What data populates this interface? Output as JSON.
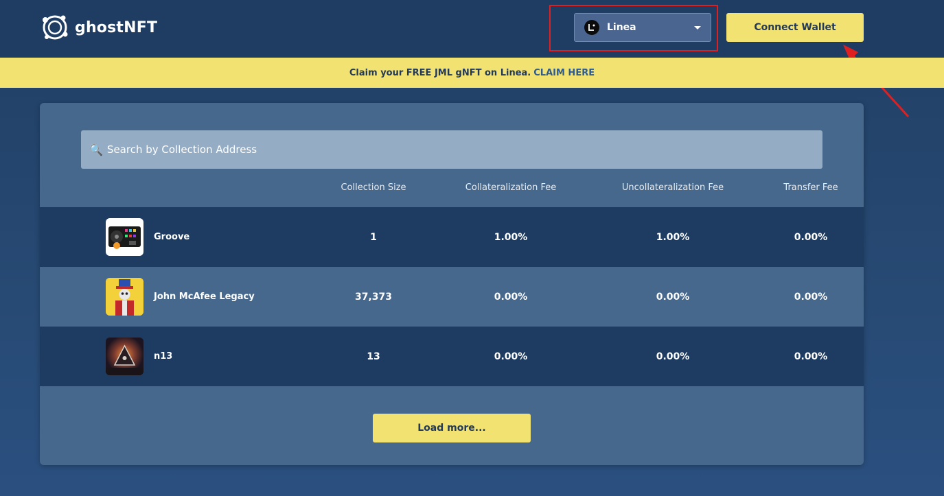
{
  "header": {
    "logo_text": "ghostNFT",
    "network": {
      "label": "Linea",
      "icon": "linea-logo-icon"
    },
    "connect_wallet_label": "Connect Wallet"
  },
  "banner": {
    "text": "Claim your FREE JML gNFT on Linea.",
    "link_label": "CLAIM HERE"
  },
  "search": {
    "placeholder": "Search by Collection Address"
  },
  "table": {
    "columns": [
      "Collection Size",
      "Collateralization Fee",
      "Uncollateralization Fee",
      "Transfer Fee"
    ],
    "rows": [
      {
        "name": "Groove",
        "size": "1",
        "collateralization_fee": "1.00%",
        "uncollateralization_fee": "1.00%",
        "transfer_fee": "0.00%"
      },
      {
        "name": "John McAfee Legacy",
        "size": "37,373",
        "collateralization_fee": "0.00%",
        "uncollateralization_fee": "0.00%",
        "transfer_fee": "0.00%"
      },
      {
        "name": "n13",
        "size": "13",
        "collateralization_fee": "0.00%",
        "uncollateralization_fee": "0.00%",
        "transfer_fee": "0.00%"
      }
    ]
  },
  "load_more_label": "Load more...",
  "colors": {
    "accent": "#f2e272",
    "header_bg": "#1f3d63",
    "card_bg": "#46688d",
    "row_dark": "#1e3c61",
    "annotation": "#e02020"
  }
}
